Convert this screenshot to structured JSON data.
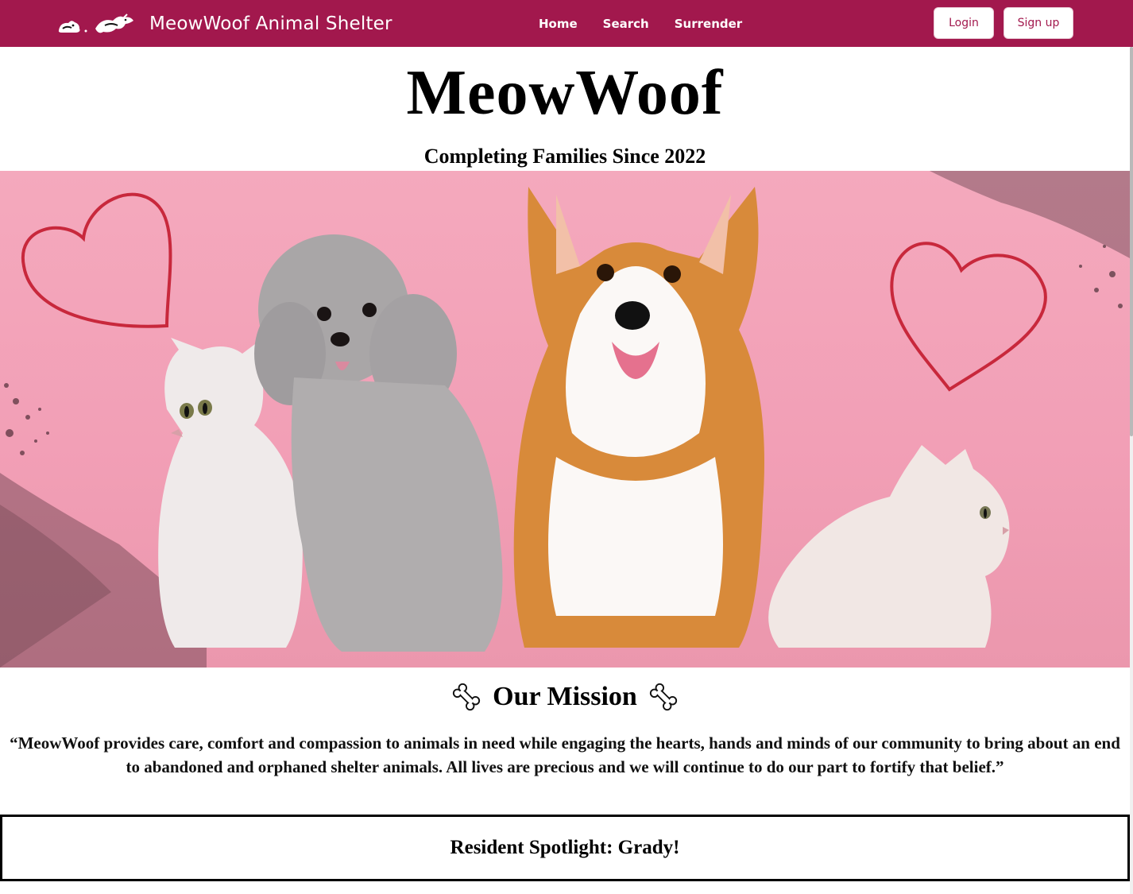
{
  "navbar": {
    "brand_name": "MeowWoof Animal Shelter",
    "brand_logo_icon": "cat-and-dog-logo-icon",
    "links": [
      {
        "label": "Home"
      },
      {
        "label": "Search"
      },
      {
        "label": "Surrender"
      }
    ],
    "login_label": "Login",
    "signup_label": "Sign up",
    "color": "#a2184d"
  },
  "hero": {
    "title": "MeowWoof",
    "tagline": "Completing Families Since 2022",
    "image_description_icon": "pets-photo"
  },
  "mission": {
    "heading": "Our Mission",
    "icon": "bone-icon",
    "text": "“MeowWoof provides care, comfort and compassion to animals in need while engaging the hearts, hands and minds of our community to bring about an end to abandoned and orphaned shelter animals. All lives are precious and we will continue to do our part to fortify that belief.”"
  },
  "spotlight": {
    "heading": "Resident Spotlight: Grady!"
  }
}
